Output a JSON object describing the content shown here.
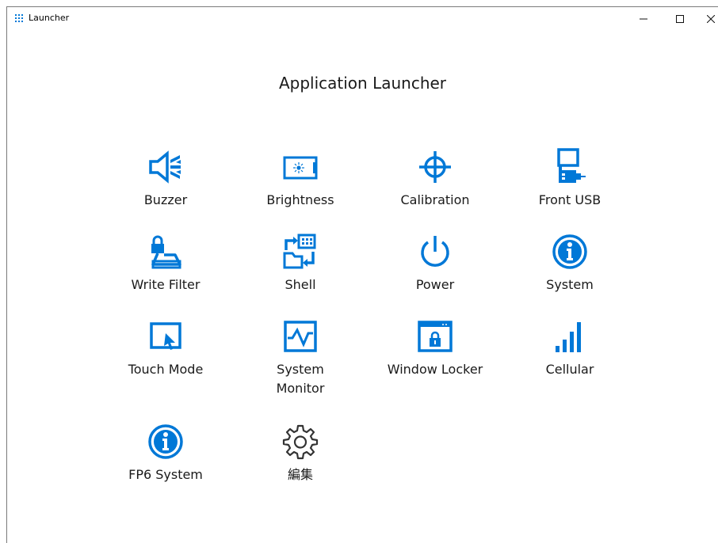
{
  "window": {
    "title": "Launcher",
    "minimize_glyph": "–",
    "maximize_glyph": "☐",
    "close_glyph": "✕"
  },
  "heading": "Application Launcher",
  "accent_color": "#0078d7",
  "apps": [
    {
      "label": "Buzzer",
      "icon": "speaker-icon"
    },
    {
      "label": "Brightness",
      "icon": "brightness-icon"
    },
    {
      "label": "Calibration",
      "icon": "crosshair-icon"
    },
    {
      "label": "Front USB",
      "icon": "usb-icon"
    },
    {
      "label": "Write Filter",
      "icon": "lock-drive-icon"
    },
    {
      "label": "Shell",
      "icon": "shell-switch-icon"
    },
    {
      "label": "Power",
      "icon": "power-icon"
    },
    {
      "label": "System",
      "icon": "info-icon"
    },
    {
      "label": "Touch Mode",
      "icon": "touch-mode-icon"
    },
    {
      "label": "System\nMonitor",
      "icon": "monitor-pulse-icon"
    },
    {
      "label": "Window Locker",
      "icon": "window-lock-icon"
    },
    {
      "label": "Cellular",
      "icon": "signal-bars-icon"
    },
    {
      "label": "FP6 System",
      "icon": "info-icon"
    },
    {
      "label": "編集",
      "icon": "gear-icon"
    }
  ]
}
